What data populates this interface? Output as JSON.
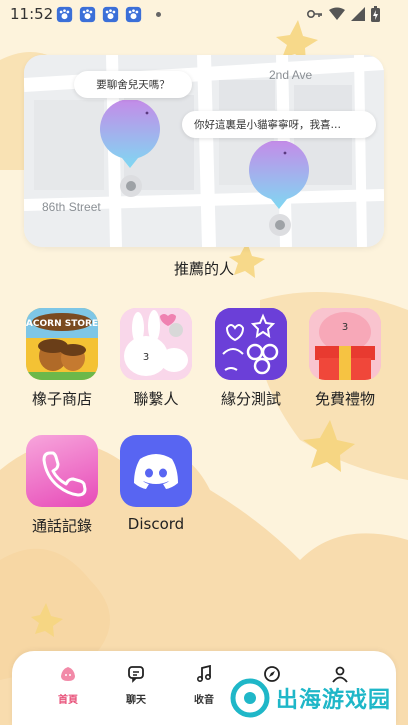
{
  "status_bar": {
    "time": "11:52",
    "app_icons": [
      "paw-icon",
      "paw-icon",
      "paw-icon",
      "paw-icon"
    ],
    "indicators": [
      "key-icon",
      "wifi-icon",
      "signal-icon",
      "battery-charging-icon"
    ]
  },
  "map": {
    "streets": {
      "top": "2nd Ave",
      "left": "86th Street"
    },
    "bubbles": [
      {
        "text": "要聊舍兒天嗎？"
      },
      {
        "text": "你好這裏是小貓寧寧呀，我喜…"
      }
    ]
  },
  "section": {
    "title": "推薦的人"
  },
  "apps": [
    {
      "label": "橡子商店",
      "icon": "acorn-store-icon",
      "badge_text": "ACORN STORE",
      "color": "#f4c234"
    },
    {
      "label": "聯繫人",
      "icon": "contacts-bunny-icon",
      "badge_text": "3",
      "color": "#f6c8e0"
    },
    {
      "label": "緣分測試",
      "icon": "fate-test-icon",
      "color": "#6b3fd8"
    },
    {
      "label": "免費禮物",
      "icon": "free-gift-icon",
      "badge_text": "3",
      "color": "#f7b3c8"
    },
    {
      "label": "通話記錄",
      "icon": "phone-icon",
      "color": "#f060b8"
    },
    {
      "label": "Discord",
      "icon": "discord-icon",
      "color": "#5865f2"
    }
  ],
  "nav": {
    "items": [
      {
        "label": "首頁",
        "icon": "home-icon",
        "active": true
      },
      {
        "label": "聊天",
        "icon": "chat-icon",
        "active": false
      },
      {
        "label": "收音",
        "icon": "music-note-icon",
        "active": false
      },
      {
        "label": "",
        "icon": "compass-icon",
        "active": false
      },
      {
        "label": "",
        "icon": "profile-icon",
        "active": false
      }
    ],
    "active_color": "#e8527a"
  },
  "watermark": {
    "text": "出海游戏园"
  }
}
